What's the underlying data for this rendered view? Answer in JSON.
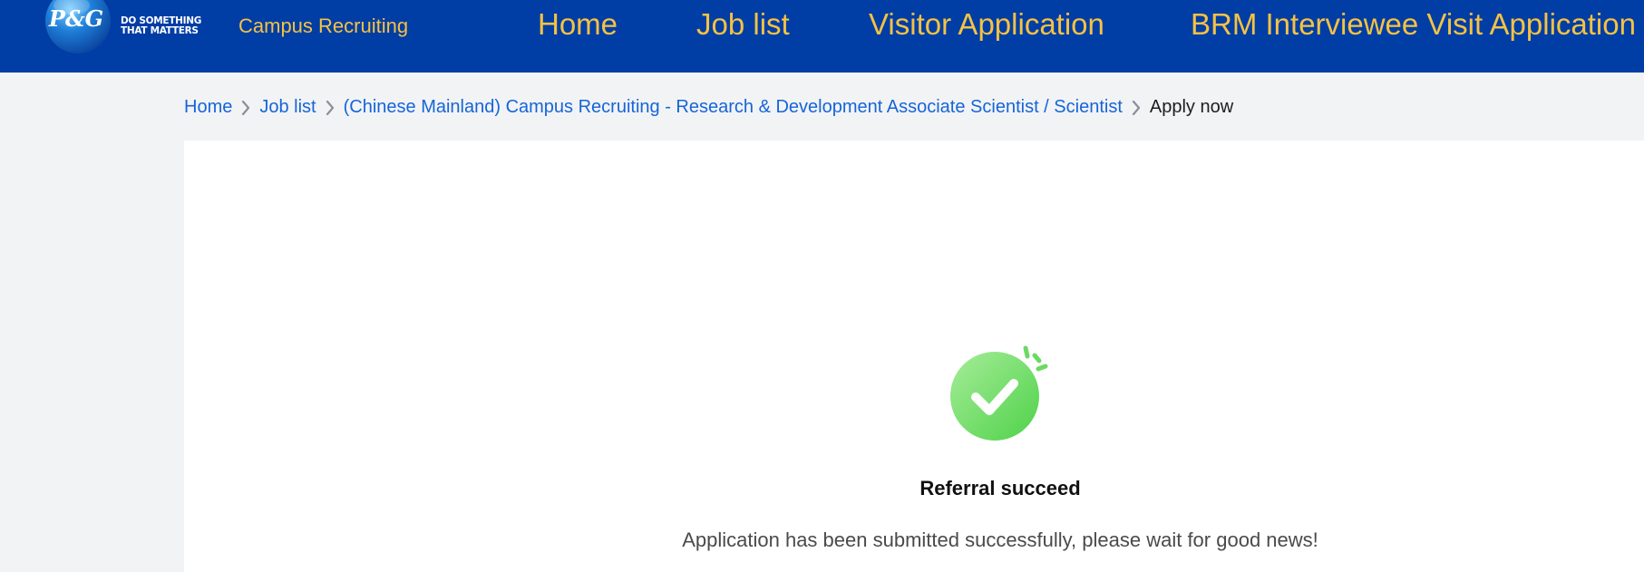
{
  "header": {
    "logo_text": "P&G",
    "tagline": "DO SOMETHING\nTHAT MATTERS",
    "brand": "Campus Recruiting",
    "nav": [
      {
        "label": "Home"
      },
      {
        "label": "Job list"
      },
      {
        "label": "Visitor Application"
      },
      {
        "label": "BRM Interviewee Visit Application"
      }
    ]
  },
  "breadcrumb": {
    "items": [
      {
        "label": "Home"
      },
      {
        "label": "Job list"
      },
      {
        "label": "(Chinese Mainland) Campus Recruiting - Research & Development Associate Scientist / Scientist"
      },
      {
        "label": "Apply now"
      }
    ]
  },
  "result": {
    "title": "Referral succeed",
    "message": "Application has been submitted successfully, please wait for good news!"
  },
  "colors": {
    "header_bg": "#003da5",
    "nav_text": "#f5c242",
    "link": "#1565d8",
    "success": "#5dd85a",
    "page_bg": "#f2f3f5"
  },
  "icons": {
    "success": "check-circle-icon",
    "breadcrumb_separator": "chevron-right-icon"
  }
}
